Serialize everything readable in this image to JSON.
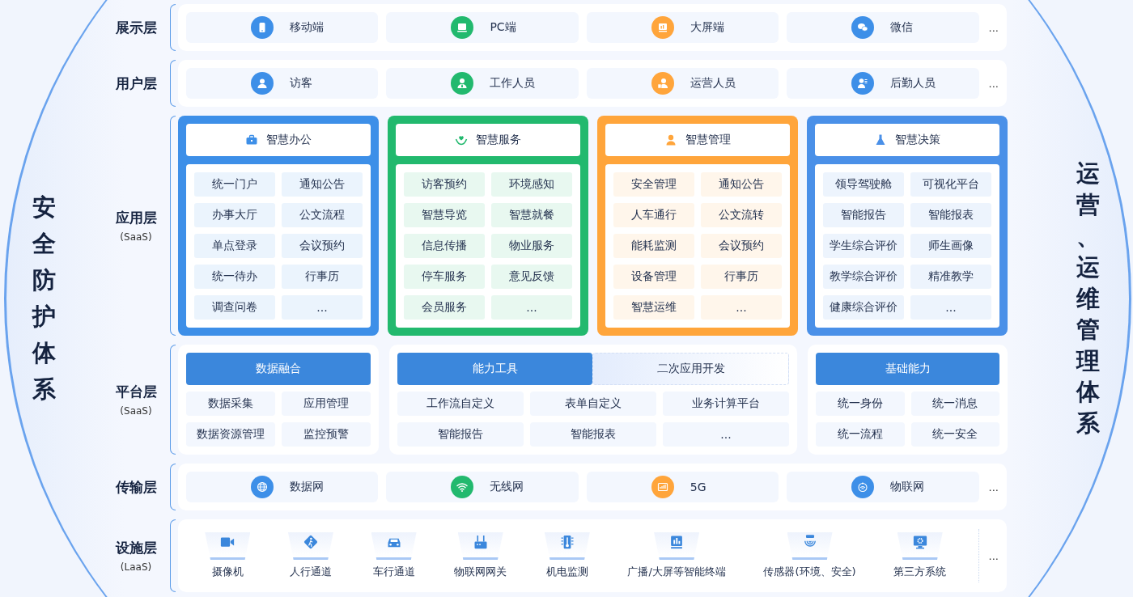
{
  "left_title": "安全防护体系",
  "right_title": "运营、运维管理体系",
  "layers": [
    {
      "kind": "icon_row",
      "title": "展示层",
      "items": [
        {
          "label": "移动端",
          "color": "#3d8fe8"
        },
        {
          "label": "PC端",
          "color": "#22b96e"
        },
        {
          "label": "大屏端",
          "color": "#ffa53b"
        },
        {
          "label": "微信",
          "color": "#3d8fe8"
        }
      ],
      "more": "..."
    },
    {
      "kind": "icon_row",
      "title": "用户层",
      "items": [
        {
          "label": "访客",
          "color": "#3d8fe8"
        },
        {
          "label": "工作人员",
          "color": "#22b96e"
        },
        {
          "label": "运营人员",
          "color": "#ffa53b"
        },
        {
          "label": "后勤人员",
          "color": "#3d8fe8"
        }
      ],
      "more": "..."
    },
    {
      "kind": "apps",
      "title": "应用层",
      "subtitle": "(SaaS)",
      "cards": [
        {
          "title": "智慧办公",
          "color": "#3d8fe8",
          "items": [
            "统一门户",
            "通知公告",
            "办事大厅",
            "公文流程",
            "单点登录",
            "会议预约",
            "统一待办",
            "行事历",
            "调查问卷",
            "..."
          ]
        },
        {
          "title": "智慧服务",
          "color": "#22b96e",
          "items": [
            "访客预约",
            "环境感知",
            "智慧导览",
            "智慧就餐",
            "信息传播",
            "物业服务",
            "停车服务",
            "意见反馈",
            "会员服务",
            "..."
          ]
        },
        {
          "title": "智慧管理",
          "color": "#ffa53b",
          "items": [
            "安全管理",
            "通知公告",
            "人车通行",
            "公文流转",
            "能耗监测",
            "会议预约",
            "设备管理",
            "行事历",
            "智慧运维",
            "..."
          ]
        },
        {
          "title": "智慧决策",
          "color": "#4a90e8",
          "items": [
            "领导驾驶舱",
            "可视化平台",
            "智能报告",
            "智能报表",
            "学生综合评价",
            "师生画像",
            "教学综合评价",
            "精准教学",
            "健康综合评价",
            "..."
          ]
        }
      ]
    },
    {
      "kind": "platform",
      "title": "平台层",
      "subtitle": "(SaaS)",
      "groups": [
        {
          "header": "数据融合",
          "items": [
            "数据采集",
            "应用管理",
            "数据资源管理",
            "监控预警"
          ]
        },
        {
          "tabs": [
            {
              "label": "能力工具",
              "selected": true
            },
            {
              "label": "二次应用开发",
              "selected": false
            }
          ],
          "items": [
            "工作流自定义",
            "表单自定义",
            "业务计算平台",
            "智能报告",
            "智能报表",
            "..."
          ]
        },
        {
          "header": "基础能力",
          "items": [
            "统一身份",
            "统一消息",
            "统一流程",
            "统一安全"
          ]
        }
      ]
    },
    {
      "kind": "icon_row",
      "title": "传输层",
      "items": [
        {
          "label": "数据网",
          "color": "#3d8fe8"
        },
        {
          "label": "无线网",
          "color": "#22b96e"
        },
        {
          "label": "5G",
          "color": "#ffa53b"
        },
        {
          "label": "物联网",
          "color": "#3d8fe8"
        }
      ],
      "more": "..."
    },
    {
      "kind": "facilities",
      "title": "设施层",
      "subtitle": "(LaaS)",
      "items": [
        "摄像机",
        "人行通道",
        "车行通道",
        "物联网网关",
        "机电监测",
        "广播/大屏等智能终端",
        "传感器(环境、安全)",
        "第三方系统"
      ],
      "more": "..."
    }
  ]
}
